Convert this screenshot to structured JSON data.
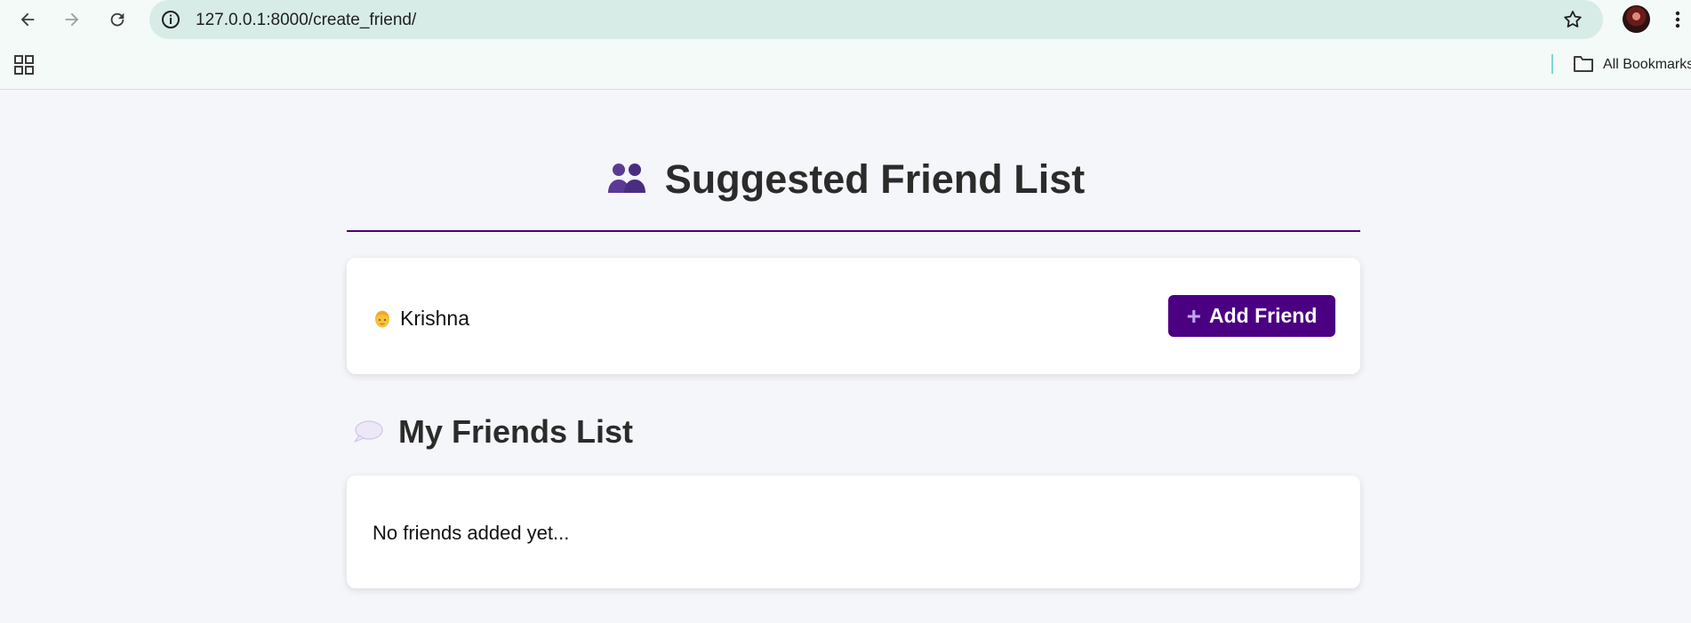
{
  "browser": {
    "url": "127.0.0.1:8000/create_friend/",
    "bookmarks_label": "All Bookmarks"
  },
  "page": {
    "title": "Suggested Friend List",
    "suggested": [
      {
        "name": "Krishna",
        "button_label": "Add Friend"
      }
    ],
    "friends_section_title": "My Friends List",
    "friends_empty_text": "No friends added yet..."
  },
  "colors": {
    "accent": "#4b0082",
    "page_bg": "#f5f6fa"
  },
  "icons": {
    "title_emoji": "people-icon",
    "friend_avatar": "person-emoji-icon",
    "section_emoji": "speech-bubble-icon",
    "add_button": "plus-icon"
  }
}
